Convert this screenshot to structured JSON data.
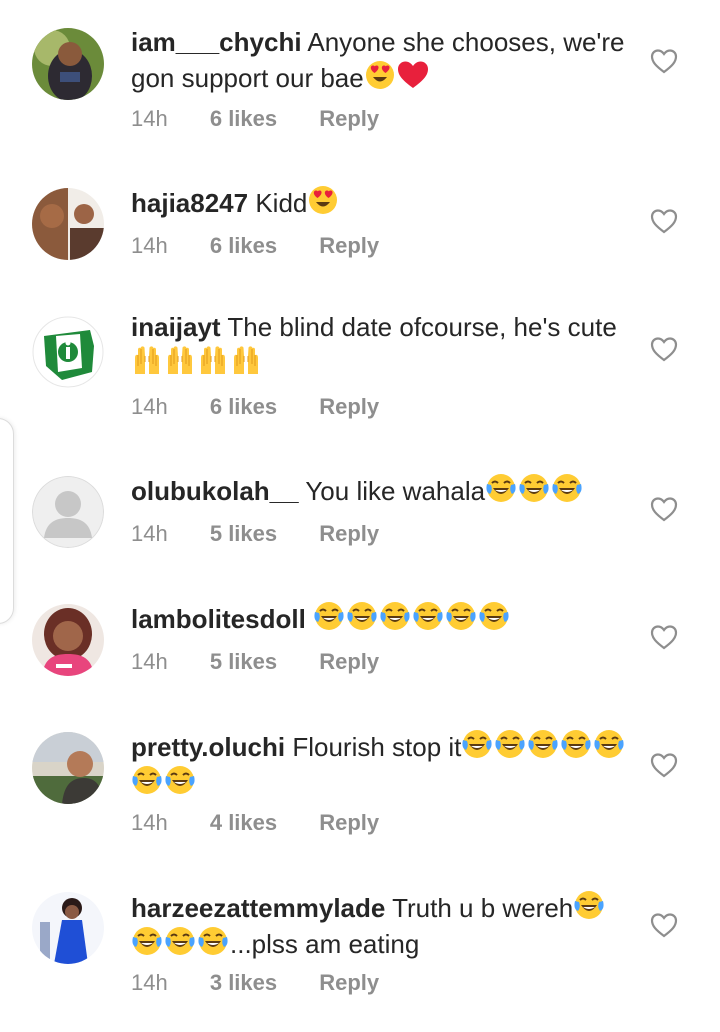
{
  "colors": {
    "text": "#262626",
    "meta": "#8e8e8e",
    "heart_outline": "#8e8e8e"
  },
  "icons": {
    "like": "heart-outline-icon",
    "laugh": "face-with-tears-of-joy-emoji",
    "love_eyes": "heart-eyes-emoji",
    "red_heart": "red-heart-emoji",
    "raised_hands": "raising-hands-emoji"
  },
  "comments": [
    {
      "username": "iam___chychi",
      "text": "Anyone she chooses, we're gon support our bae",
      "emoji_after": [
        "love_eyes",
        "red_heart"
      ],
      "time": "14h",
      "likes": "6 likes",
      "reply": "Reply"
    },
    {
      "username": "hajia8247",
      "text": "Kidd",
      "emoji_after": [
        "love_eyes"
      ],
      "time": "14h",
      "likes": "6 likes",
      "reply": "Reply"
    },
    {
      "username": "inaijayt",
      "text": "The blind date ofcourse,  he's cute",
      "emoji_after": [
        "raised_hands",
        "raised_hands",
        "raised_hands",
        "raised_hands"
      ],
      "time": "14h",
      "likes": "6 likes",
      "reply": "Reply"
    },
    {
      "username": "olubukolah__",
      "text": "You like wahala",
      "emoji_after": [
        "laugh",
        "laugh",
        "laugh"
      ],
      "time": "14h",
      "likes": "5 likes",
      "reply": "Reply"
    },
    {
      "username": "lambolitesdoll",
      "text": "",
      "emoji_after": [
        "laugh",
        "laugh",
        "laugh",
        "laugh",
        "laugh",
        "laugh"
      ],
      "time": "14h",
      "likes": "5 likes",
      "reply": "Reply"
    },
    {
      "username": "pretty.oluchi",
      "text": "Flourish stop it",
      "emoji_after": [
        "laugh",
        "laugh",
        "laugh",
        "laugh",
        "laugh",
        "laugh",
        "laugh"
      ],
      "time": "14h",
      "likes": "4 likes",
      "reply": "Reply"
    },
    {
      "username": "harzeezattemmylade",
      "text": "Truth u b wereh",
      "emoji_after": [
        "laugh",
        "laugh",
        "laugh",
        "laugh"
      ],
      "text_after": "...plss am eating",
      "time": "14h",
      "likes": "3 likes",
      "reply": "Reply"
    }
  ]
}
